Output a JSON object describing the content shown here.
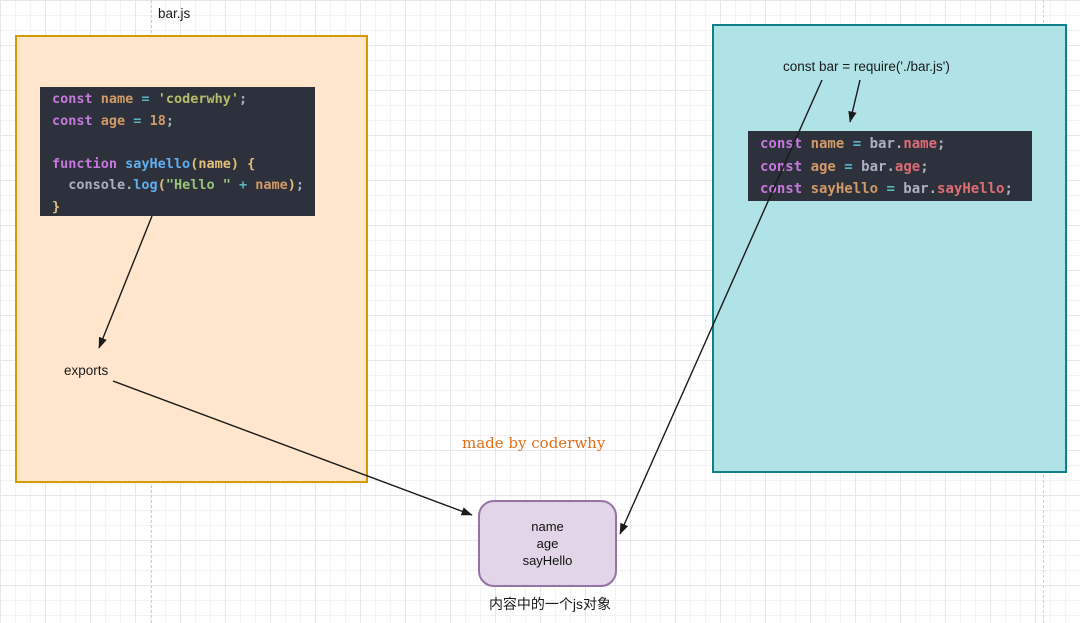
{
  "labels": {
    "file_title": "bar.js",
    "require_statement": "const bar = require('./bar.js')",
    "exports_label": "exports",
    "watermark": "made by coderwhy",
    "object_caption": "内容中的一个js对象"
  },
  "object_box": {
    "lines": [
      "name",
      "age",
      "sayHello"
    ]
  },
  "colors": {
    "module_box_fill": "#ffe6cc",
    "module_box_stroke": "#d79b00",
    "import_box_fill": "#b0e3e6",
    "import_box_stroke": "#0e8088",
    "object_box_fill": "#e1d5e7",
    "object_box_stroke": "#9673a6",
    "code_bg": "#2d313c",
    "watermark_color": "#e0701a",
    "arrow_color": "#1a1a1a"
  },
  "token_colors": {
    "kw": "#c678dd",
    "var": "#d19a66",
    "op": "#56b6c2",
    "str": "#b5bd68",
    "str2": "#98c379",
    "num": "#d19a66",
    "fn": "#61afef",
    "paren": "#e5c07b",
    "param": "#e5c07b",
    "plain": "#abb2bf",
    "prop": "#e06c75"
  },
  "code_blocks": {
    "bar_js": {
      "lines": [
        [
          [
            "const ",
            "kw"
          ],
          [
            "name ",
            "var"
          ],
          [
            "= ",
            "op"
          ],
          [
            "'coderwhy'",
            "str"
          ],
          [
            ";",
            "plain"
          ]
        ],
        [
          [
            "const ",
            "kw"
          ],
          [
            "age ",
            "var"
          ],
          [
            "= ",
            "op"
          ],
          [
            "18",
            "num"
          ],
          [
            ";",
            "plain"
          ]
        ],
        [],
        [
          [
            "function ",
            "kw"
          ],
          [
            "sayHello",
            "fn"
          ],
          [
            "(",
            "paren"
          ],
          [
            "name",
            "param"
          ],
          [
            ") {",
            "paren"
          ]
        ],
        [
          [
            "  console",
            "plain"
          ],
          [
            ".",
            "plain"
          ],
          [
            "log",
            "fn"
          ],
          [
            "(",
            "paren"
          ],
          [
            "\"Hello \" ",
            "str2"
          ],
          [
            "+ ",
            "op"
          ],
          [
            "name",
            "var"
          ],
          [
            ")",
            "paren"
          ],
          [
            ";",
            "plain"
          ]
        ],
        [
          [
            "}",
            "paren"
          ]
        ]
      ]
    },
    "main_js": {
      "lines": [
        [
          [
            "const ",
            "kw"
          ],
          [
            "name ",
            "var"
          ],
          [
            "= ",
            "op"
          ],
          [
            "bar",
            "plain"
          ],
          [
            ".",
            "plain"
          ],
          [
            "name",
            "prop"
          ],
          [
            ";",
            "plain"
          ]
        ],
        [
          [
            "const ",
            "kw"
          ],
          [
            "age ",
            "var"
          ],
          [
            "= ",
            "op"
          ],
          [
            "bar",
            "plain"
          ],
          [
            ".",
            "plain"
          ],
          [
            "age",
            "prop"
          ],
          [
            ";",
            "plain"
          ]
        ],
        [
          [
            "const ",
            "kw"
          ],
          [
            "sayHello ",
            "var"
          ],
          [
            "= ",
            "op"
          ],
          [
            "bar",
            "plain"
          ],
          [
            ".",
            "plain"
          ],
          [
            "sayHello",
            "prop"
          ],
          [
            ";",
            "plain"
          ]
        ]
      ]
    }
  }
}
